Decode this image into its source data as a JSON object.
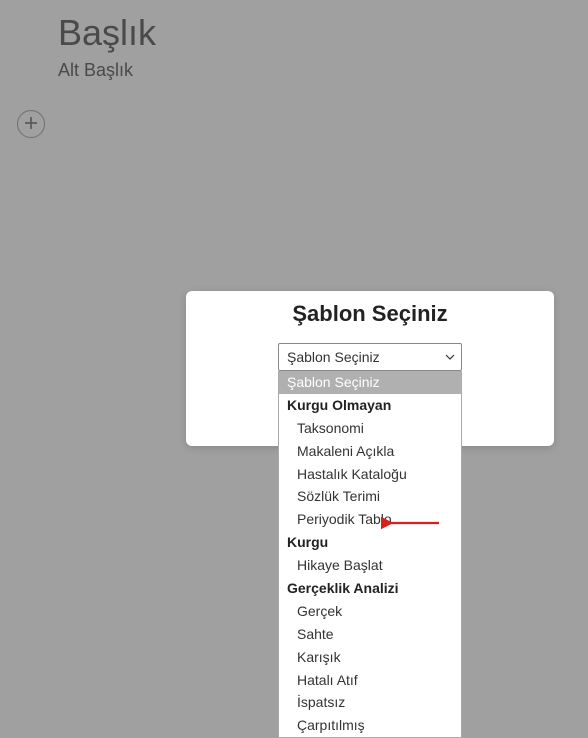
{
  "header": {
    "title": "Başlık",
    "subtitle": "Alt Başlık"
  },
  "modal": {
    "title": "Şablon Seçiniz",
    "selected": "Şablon Seçiniz"
  },
  "dropdown": {
    "placeholder": "Şablon Seçiniz",
    "groups": [
      {
        "label": "Kurgu Olmayan",
        "items": [
          "Taksonomi",
          "Makaleni Açıkla",
          "Hastalık Kataloğu",
          "Sözlük Terimi",
          "Periyodik Tablo"
        ]
      },
      {
        "label": "Kurgu",
        "items": [
          "Hikaye Başlat"
        ]
      },
      {
        "label": "Gerçeklik Analizi",
        "items": [
          "Gerçek",
          "Sahte",
          "Karışık",
          "Hatalı Atıf",
          "İspatsız",
          "Çarpıtılmış"
        ]
      }
    ]
  }
}
